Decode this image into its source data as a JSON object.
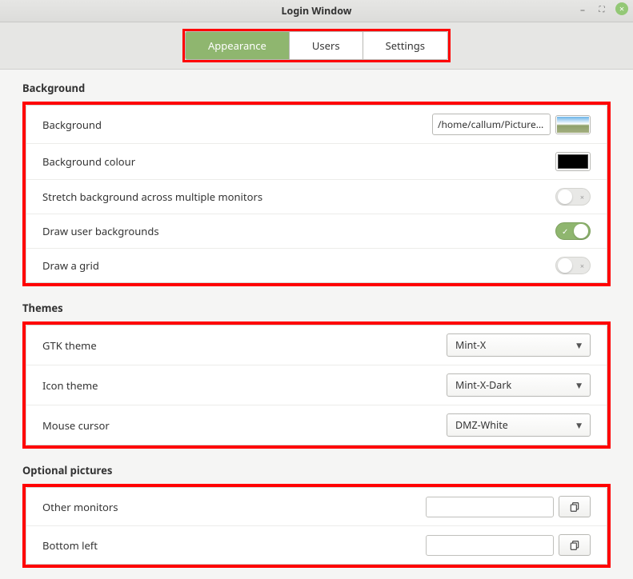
{
  "window": {
    "title": "Login Window"
  },
  "tabs": {
    "appearance": "Appearance",
    "users": "Users",
    "settings": "Settings"
  },
  "sections": {
    "background_title": "Background",
    "themes_title": "Themes",
    "optional_pictures_title": "Optional pictures"
  },
  "background": {
    "background_label": "Background",
    "background_path": "/home/callum/Pictures/ca",
    "colour_label": "Background colour",
    "colour_value": "#000000",
    "stretch_label": "Stretch background across multiple monitors",
    "stretch_on": false,
    "draw_user_label": "Draw user backgrounds",
    "draw_user_on": true,
    "draw_grid_label": "Draw a grid",
    "draw_grid_on": false
  },
  "themes": {
    "gtk_label": "GTK theme",
    "gtk_value": "Mint-X",
    "icon_label": "Icon theme",
    "icon_value": "Mint-X-Dark",
    "cursor_label": "Mouse cursor",
    "cursor_value": "DMZ-White"
  },
  "optional": {
    "other_monitors_label": "Other monitors",
    "other_monitors_value": "",
    "bottom_left_label": "Bottom left",
    "bottom_left_value": ""
  }
}
